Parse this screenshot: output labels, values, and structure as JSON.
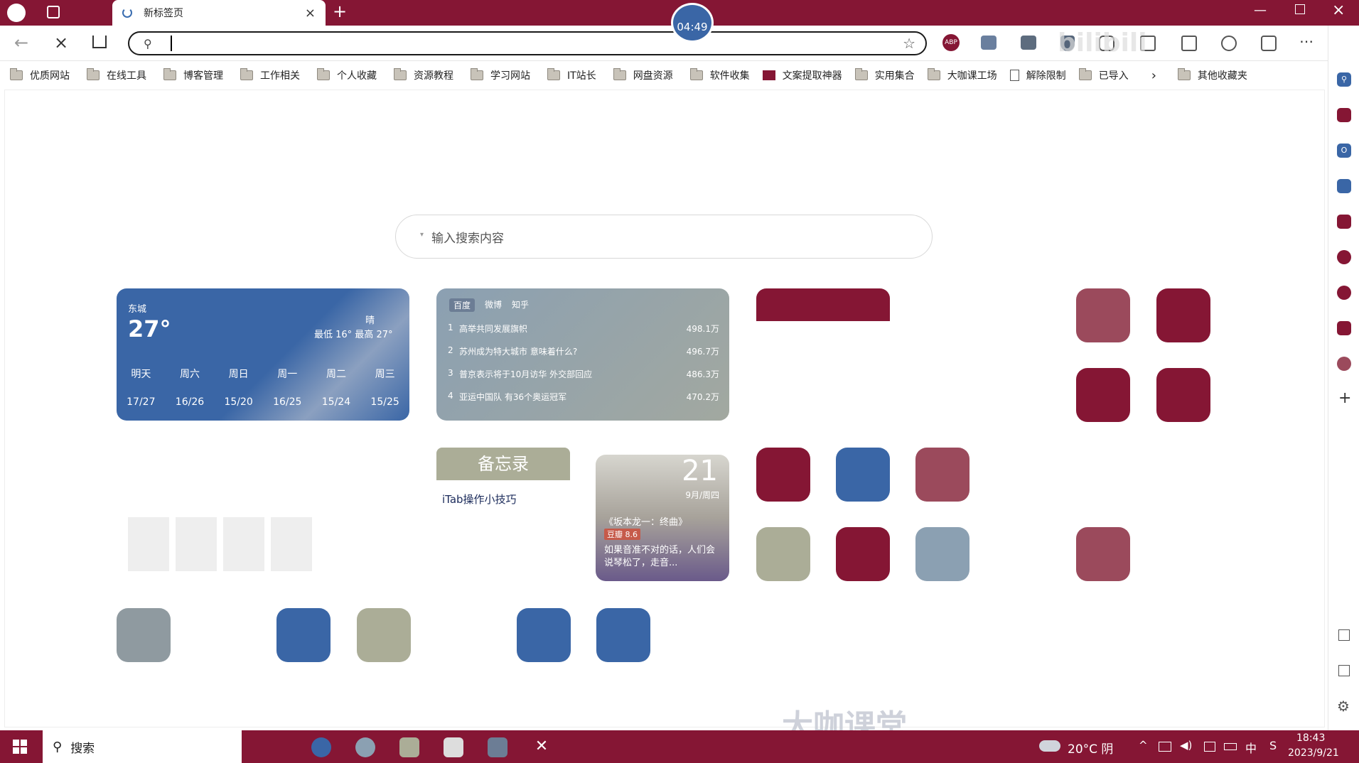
{
  "browser": {
    "tab_title": "新标签页",
    "timer": "04:49",
    "address_value": "",
    "bookmarks": [
      "优质网站",
      "在线工具",
      "博客管理",
      "工作相关",
      "个人收藏",
      "资源教程",
      "学习网站",
      "IT站长",
      "网盘资源",
      "软件收集",
      "文案提取神器",
      "实用集合",
      "大咖课工场",
      "解除限制",
      "已导入"
    ],
    "other_bookmarks": "其他收藏夹",
    "more": "›",
    "watermark": "大咖课堂"
  },
  "search": {
    "placeholder": "输入搜索内容"
  },
  "weather": {
    "city": "东城",
    "temp": "27°",
    "condition": "晴",
    "range": "最低 16° 最高 27°",
    "days": [
      "明天",
      "周六",
      "周日",
      "周一",
      "周二",
      "周三"
    ],
    "temps": [
      "17/27",
      "16/26",
      "15/20",
      "16/25",
      "15/24",
      "15/25"
    ]
  },
  "hot": {
    "tabs": [
      "百度",
      "微博",
      "知乎"
    ],
    "items": [
      {
        "rank": "1",
        "title": "高举共同发展旗帜",
        "heat": "498.1万"
      },
      {
        "rank": "2",
        "title": "苏州成为特大城市 意味着什么?",
        "heat": "496.7万"
      },
      {
        "rank": "3",
        "title": "普京表示将于10月访华 外交部回应",
        "heat": "486.3万"
      },
      {
        "rank": "4",
        "title": "亚运中国队 有36个奥运冠军",
        "heat": "470.2万"
      }
    ]
  },
  "memo": {
    "title": "备忘录",
    "item": "iTab操作小技巧"
  },
  "movie": {
    "day": "21",
    "date": "9月/周四",
    "name": "《坂本龙一：终曲》",
    "score": "豆瓣 8.6",
    "quote": "如果音准不对的话，人们会说琴松了，走音..."
  },
  "colors": {
    "accent": "#851634",
    "blue": "#3a66a6",
    "sage": "#abad97"
  },
  "taskbar": {
    "search": "搜索",
    "weather": "20°C 阴",
    "ime": "中",
    "time": "18:43",
    "date": "2023/9/21"
  }
}
